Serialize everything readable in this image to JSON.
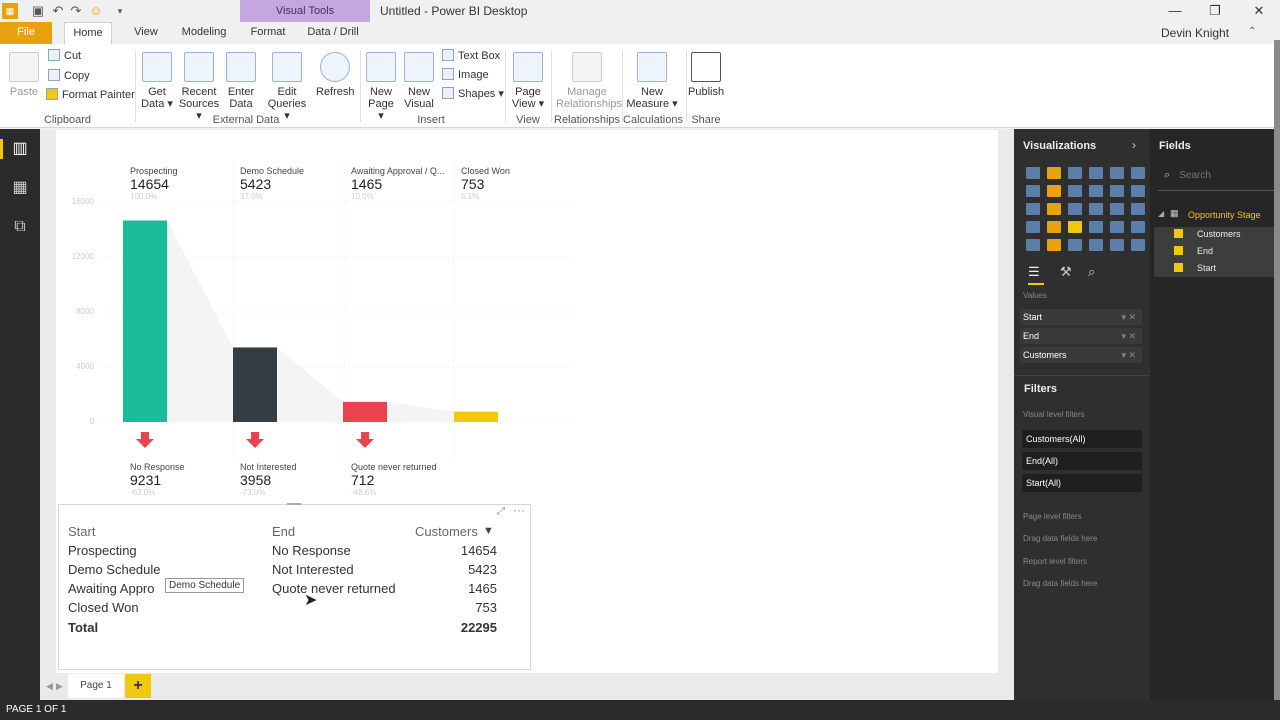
{
  "window": {
    "title": "Untitled - Power BI Desktop",
    "context_tab": "Visual Tools",
    "user": "Devin Knight",
    "controls": [
      "—",
      "❐",
      "✕"
    ]
  },
  "ribbon_tabs": [
    "File",
    "Home",
    "View",
    "Modeling",
    "Format",
    "Data / Drill"
  ],
  "ribbon": {
    "clipboard": {
      "paste": "Paste",
      "cut": "Cut",
      "copy": "Copy",
      "format_painter": "Format Painter",
      "group": "Clipboard"
    },
    "external": {
      "get_data": "Get Data ▾",
      "recent_sources": "Recent Sources ▾",
      "enter_data": "Enter Data",
      "edit_queries": "Edit Queries ▾",
      "refresh": "Refresh",
      "group": "External Data"
    },
    "insert": {
      "new_page": "New Page ▾",
      "new_visual": "New Visual",
      "text_box": "Text Box",
      "image": "Image",
      "shapes": "Shapes ▾",
      "group": "Insert"
    },
    "view": {
      "page_view": "Page View ▾",
      "group": "View"
    },
    "relationships": {
      "manage": "Manage Relationships",
      "group": "Relationships"
    },
    "calculations": {
      "new_measure": "New Measure ▾",
      "group": "Calculations"
    },
    "share": {
      "publish": "Publish",
      "group": "Share"
    }
  },
  "funnel": {
    "stages": [
      {
        "label": "Prospecting",
        "value": "14654",
        "pct": "100.0%"
      },
      {
        "label": "Demo Schedule",
        "value": "5423",
        "pct": "37.0%"
      },
      {
        "label": "Awaiting Approval / Q...",
        "value": "1465",
        "pct": "10.0%"
      },
      {
        "label": "Closed Won",
        "value": "753",
        "pct": "5.1%"
      }
    ],
    "drops": [
      {
        "label": "No Response",
        "value": "9231",
        "pct": "-63.0%"
      },
      {
        "label": "Not Interested",
        "value": "3958",
        "pct": "-73.0%"
      },
      {
        "label": "Quote never returned",
        "value": "712",
        "pct": "-48.6%"
      }
    ],
    "yticks": [
      "16000",
      "12000",
      "8000",
      "4000",
      "0"
    ]
  },
  "chart_data": {
    "type": "bar",
    "categories": [
      "Prospecting",
      "Demo Schedule",
      "Awaiting Approval / Q...",
      "Closed Won"
    ],
    "values": [
      14654,
      5423,
      1465,
      753
    ],
    "ylim": [
      0,
      16000
    ],
    "colors": [
      "#1abc9c",
      "#333d43",
      "#e8434f",
      "#f2c80f"
    ]
  },
  "table": {
    "headers": {
      "start": "Start",
      "end": "End",
      "customers": "Customers"
    },
    "rows": [
      {
        "start": "Prospecting",
        "end": "No Response",
        "customers": "14654"
      },
      {
        "start": "Demo Schedule",
        "end": "Not Interested",
        "customers": "5423"
      },
      {
        "start": "Awaiting Appro",
        "end": "Quote never returned",
        "customers": "1465"
      },
      {
        "start": "Closed Won",
        "end": "",
        "customers": "753"
      }
    ],
    "total_label": "Total",
    "total_value": "22295",
    "tooltip": "Demo Schedule"
  },
  "pages": {
    "tab": "Page 1",
    "add": "+",
    "status": "PAGE 1 OF 1"
  },
  "viz_pane": {
    "title": "Visualizations",
    "values_label": "Values",
    "wells": [
      "Start",
      "End",
      "Customers"
    ],
    "filters_title": "Filters",
    "visual_filters": "Visual level filters",
    "filter_items": [
      "Customers(All)",
      "End(All)",
      "Start(All)"
    ],
    "page_filters": "Page level filters",
    "drag_here": "Drag data fields here",
    "report_filters": "Report level filters"
  },
  "fields_pane": {
    "title": "Fields",
    "search_placeholder": "Search",
    "table": "Opportunity Stage",
    "fields": [
      "Customers",
      "End",
      "Start"
    ]
  }
}
